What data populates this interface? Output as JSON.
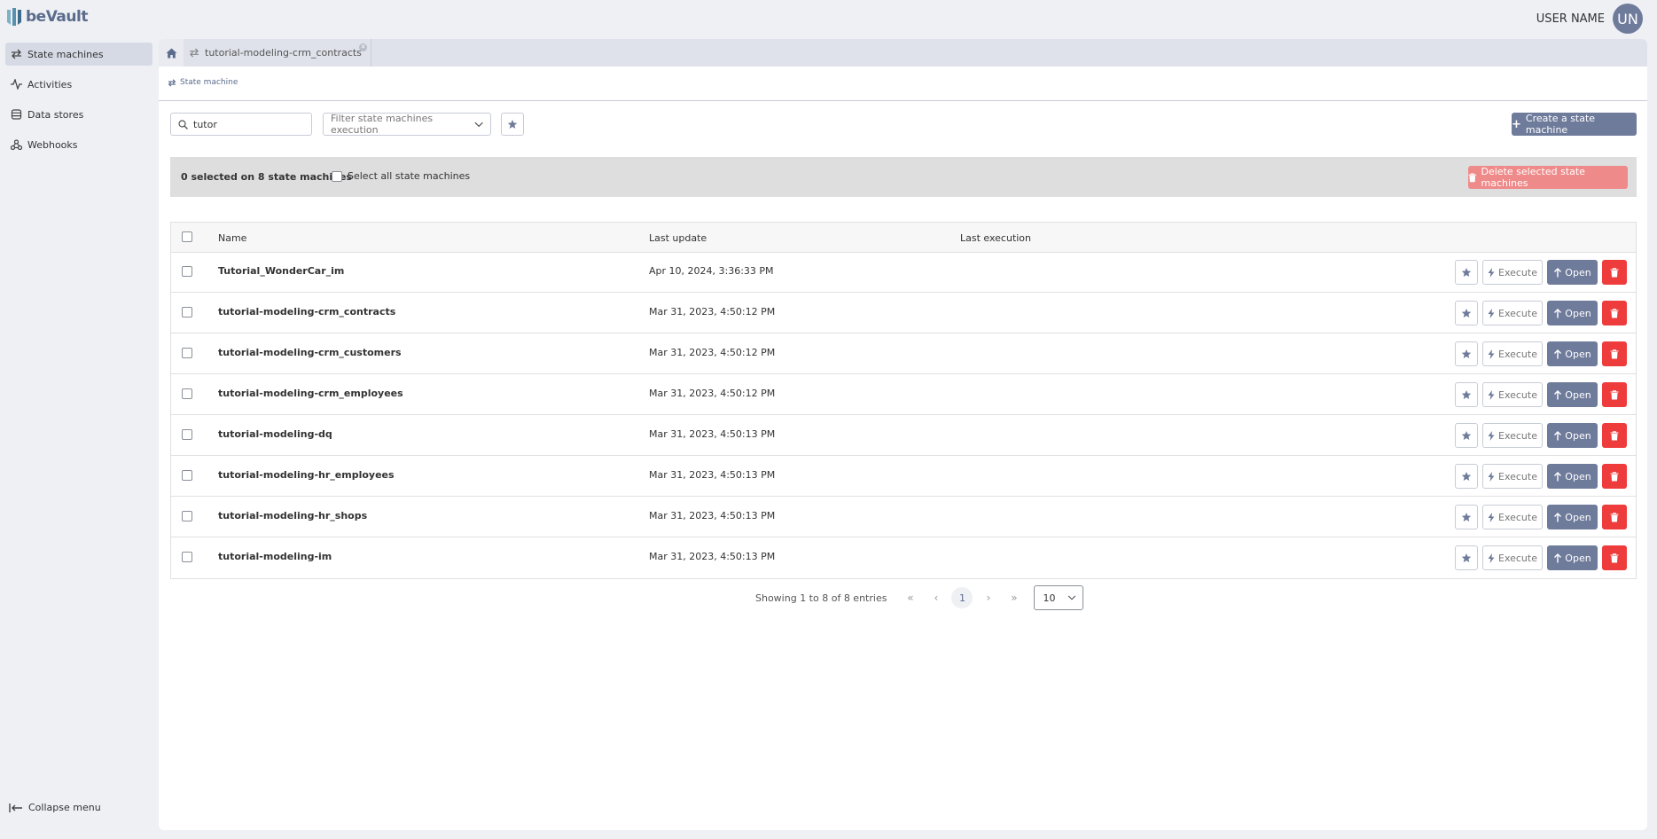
{
  "app": {
    "logo_text": "beVault",
    "user_name": "USER NAME",
    "avatar_initials": "UN"
  },
  "colors": {
    "accent": "#6f7b9b",
    "danger": "#ee3b3b",
    "danger_light": "#ef8a8a"
  },
  "sidebar": {
    "items": [
      {
        "label": "State machines",
        "icon": "arrows-exchange-icon",
        "active": true
      },
      {
        "label": "Activities",
        "icon": "activity-icon",
        "active": false
      },
      {
        "label": "Data stores",
        "icon": "database-icon",
        "active": false
      },
      {
        "label": "Webhooks",
        "icon": "webhook-icon",
        "active": false
      }
    ],
    "collapse_label": "Collapse menu"
  },
  "tabs": {
    "open_tab_label": "tutorial-modeling-crm_contracts"
  },
  "breadcrumb": {
    "label": "State machine"
  },
  "toolbar": {
    "search_value": "tutor",
    "filter_placeholder": "Filter state machines execution",
    "create_label": "Create a state machine"
  },
  "selection": {
    "count_text": "0 selected on 8 state machines",
    "select_all_label": "Select all state machines",
    "delete_selected_label": "Delete selected state machines"
  },
  "table": {
    "columns": {
      "name": "Name",
      "last_update": "Last update",
      "last_execution": "Last execution"
    },
    "action_labels": {
      "execute": "Execute",
      "open": "Open"
    },
    "rows": [
      {
        "name": "Tutorial_WonderCar_im",
        "last_update": "Apr 10, 2024, 3:36:33 PM",
        "last_execution": ""
      },
      {
        "name": "tutorial-modeling-crm_contracts",
        "last_update": "Mar 31, 2023, 4:50:12 PM",
        "last_execution": ""
      },
      {
        "name": "tutorial-modeling-crm_customers",
        "last_update": "Mar 31, 2023, 4:50:12 PM",
        "last_execution": ""
      },
      {
        "name": "tutorial-modeling-crm_employees",
        "last_update": "Mar 31, 2023, 4:50:12 PM",
        "last_execution": ""
      },
      {
        "name": "tutorial-modeling-dq",
        "last_update": "Mar 31, 2023, 4:50:13 PM",
        "last_execution": ""
      },
      {
        "name": "tutorial-modeling-hr_employees",
        "last_update": "Mar 31, 2023, 4:50:13 PM",
        "last_execution": ""
      },
      {
        "name": "tutorial-modeling-hr_shops",
        "last_update": "Mar 31, 2023, 4:50:13 PM",
        "last_execution": ""
      },
      {
        "name": "tutorial-modeling-im",
        "last_update": "Mar 31, 2023, 4:50:13 PM",
        "last_execution": ""
      }
    ]
  },
  "pagination": {
    "info": "Showing 1 to 8 of 8 entries",
    "first": "«",
    "prev": "‹",
    "current_page": "1",
    "next": "›",
    "last": "»",
    "page_size": "10"
  }
}
